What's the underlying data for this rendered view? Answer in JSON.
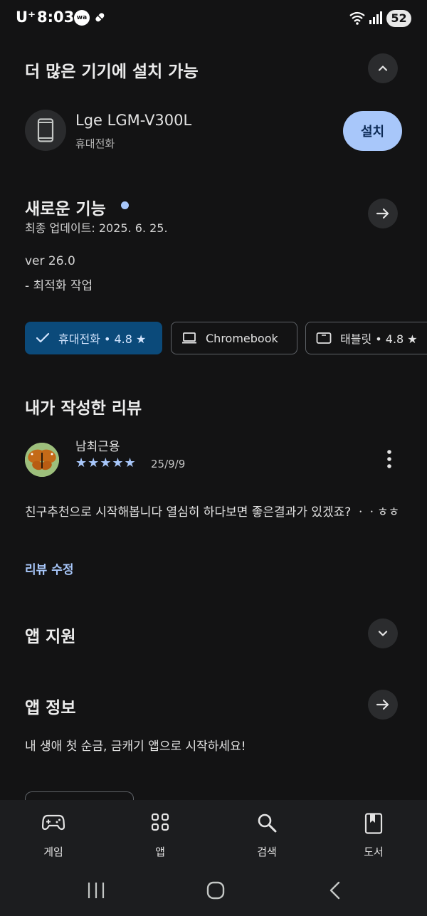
{
  "status_bar": {
    "carrier": "U⁺",
    "time": "8:03",
    "wa_badge": "wa",
    "battery": "52"
  },
  "devices_section": {
    "title": "더 많은 기기에 설치 가능",
    "device_name": "Lge LGM-V300L",
    "device_type": "휴대전화",
    "install_label": "설치"
  },
  "whats_new": {
    "title": "새로운 기능",
    "last_updated": "최종 업데이트: 2025. 6. 25.",
    "version": "ver 26.0",
    "notes": "- 최적화 작업"
  },
  "device_chips": [
    {
      "label": "휴대전화 • 4.8 ★",
      "icon": "check-icon",
      "selected": true
    },
    {
      "label": "Chromebook",
      "icon": "laptop-icon",
      "selected": false
    },
    {
      "label": "태블릿 • 4.8 ★",
      "icon": "tablet-icon",
      "selected": false
    }
  ],
  "my_review": {
    "title": "내가 작성한 리뷰",
    "reviewer": "남최근용",
    "stars": "★★★★★",
    "rating": 5,
    "date": "25/9/9",
    "text": "친구추천으로 시작해봅니다 열심히 하다보면 좋은결과가 있겠죠? ㆍㆍㅎㅎ",
    "edit_label": "리뷰 수정"
  },
  "app_support": {
    "title": "앱 지원"
  },
  "app_info": {
    "title": "앱 정보",
    "description": "내 생애 첫 순금, 금캐기 앱으로 시작하세요!"
  },
  "bottom_nav": [
    {
      "label": "게임",
      "icon": "gamepad-icon"
    },
    {
      "label": "앱",
      "icon": "apps-grid-icon"
    },
    {
      "label": "검색",
      "icon": "search-icon"
    },
    {
      "label": "도서",
      "icon": "book-icon"
    }
  ],
  "colors": {
    "background": "#131314",
    "accent": "#a8c7fa",
    "selected_chip": "#0b4a7a",
    "nav_background": "#1c1d1f"
  }
}
